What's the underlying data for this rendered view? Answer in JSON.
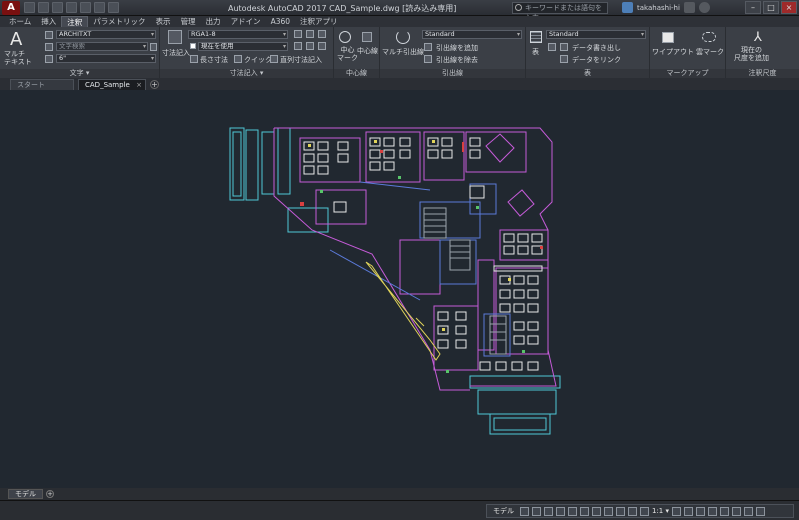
{
  "window": {
    "title": "Autodesk AutoCAD 2017    CAD_Sample.dwg [読み込み専用]",
    "search_placeholder": "キーワードまたは語句を入力",
    "user_name": "takahashi-hi",
    "app_letter": "A"
  },
  "ribbon_tabs": [
    "ホーム",
    "挿入",
    "注釈",
    "パラメトリック",
    "表示",
    "管理",
    "出力",
    "アドイン",
    "A360",
    "注釈アプリ"
  ],
  "ribbon": {
    "text_group": {
      "label": "文字 ▾",
      "multiline_text": "マルチ\nテキスト",
      "style_value": "ARCHITXT",
      "search_placeholder": "文字検索",
      "height_value": "6\""
    },
    "dim_group": {
      "label": "寸法記入 ▾",
      "dim_button": "寸法記入",
      "style_value": "RGA1-8",
      "layer_value": "現在を使用",
      "tool_length": "長さ寸法",
      "tool_quick": "クイック",
      "tool_continuous": "直列寸法記入"
    },
    "center_group": {
      "label": "中心線",
      "center_mark": "中心\nマーク",
      "center_line": "中心線"
    },
    "leader_group": {
      "label": "引出線",
      "multileader": "マルチ引出線",
      "style_value": "Standard",
      "add_leader": "引出線を追加",
      "remove_leader": "引出線を除去"
    },
    "table_group": {
      "label": "表",
      "table_button": "表",
      "style_value": "Standard",
      "extract_data": "データ書き出し",
      "link_data": "データをリンク"
    },
    "markup_group": {
      "label": "マークアップ",
      "wipeout": "ワイプアウト",
      "cloud": "雲マーク"
    },
    "scale_group": {
      "label": "注釈尺度",
      "add_current_scale": "現在の\n尺度を追加"
    }
  },
  "file_tabs": {
    "start": "スタート",
    "active": "CAD_Sample"
  },
  "layout_tabs": {
    "model": "モデル"
  },
  "status_bar": {
    "mode": "モデル",
    "scale": "1:1 ▾"
  },
  "colors": {
    "canvas_bg": "#212830",
    "wall_magenta": "#c55bd8",
    "wall_cyan": "#4fc7d6",
    "furniture_white": "#e8e8e8",
    "dim_yellow": "#e0d35a",
    "accent_green": "#58c46a",
    "accent_red": "#d94040",
    "wall_blue": "#5b7ad9"
  },
  "icons": [
    "autocad-logo-icon",
    "search-icon",
    "user-icon",
    "help-icon",
    "minimize-icon",
    "maximize-icon",
    "close-icon"
  ]
}
